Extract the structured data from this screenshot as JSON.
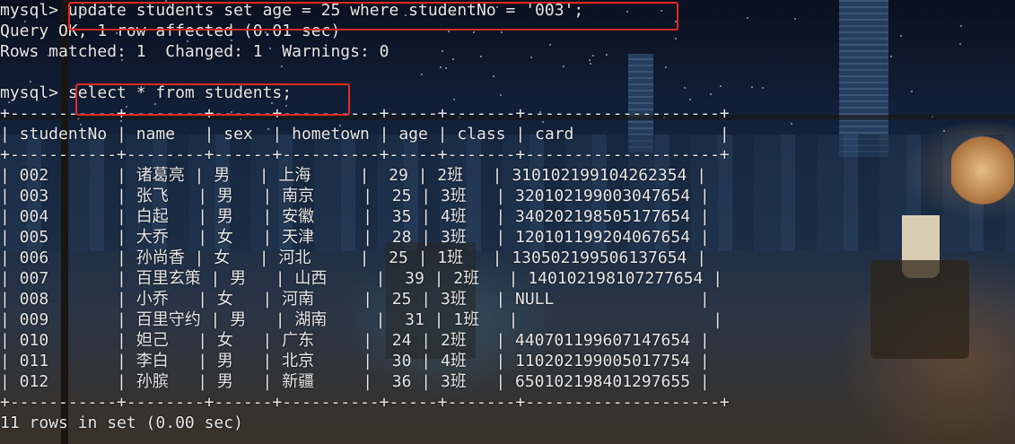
{
  "terminal": {
    "lines": [
      "mysql> update students set age = 25 where studentNo = '003';",
      "Query OK, 1 row affected (0.01 sec)",
      "Rows matched: 1  Changed: 1  Warnings: 0",
      "",
      "mysql> select * from students;",
      "+-----------+--------+------+----------+-----+-------+--------------------+",
      "| studentNo | name   | sex  | hometown | age | class | card               |",
      "+-----------+--------+------+----------+-----+-------+--------------------+",
      "| 002       | 诸葛亮 | 男   | 上海     |  29 | 2班   | 310102199104262354 |",
      "| 003       | 张飞   | 男   | 南京     |  25 | 3班   | 320102199003047654 |",
      "| 004       | 白起   | 男   | 安徽     |  35 | 4班   | 340202198505177654 |",
      "| 005       | 大乔   | 女   | 天津     |  28 | 3班   | 120101199204067654 |",
      "| 006       | 孙尚香 | 女   | 河北     |  25 | 1班   | 130502199506137654 |",
      "| 007       | 百里玄策 | 男   | 山西     |  39 | 2班   | 140102198107277654 |",
      "| 008       | 小乔   | 女   | 河南     |  25 | 3班   | NULL               |",
      "| 009       | 百里守约 | 男   | 湖南     |  31 | 1班   |                    |",
      "| 010       | 妲己   | 女   | 广东     |  24 | 2班   | 440701199607147654 |",
      "| 011       | 李白   | 男   | 北京     |  30 | 4班   | 110202199005017754 |",
      "| 012       | 孙膑   | 男   | 新疆     |  36 | 3班   | 650102198401297655 |",
      "+-----------+--------+------+----------+-----+-------+--------------------+",
      "11 rows in set (0.00 sec)"
    ],
    "colors": {
      "text": "#e6e6e6",
      "highlight": "#e12a20"
    }
  }
}
